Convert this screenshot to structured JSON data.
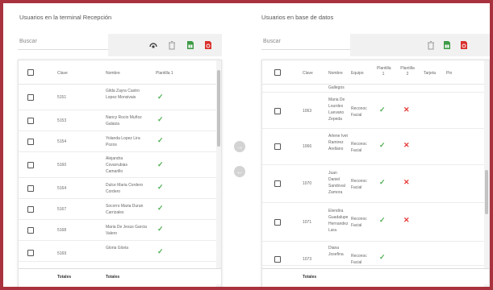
{
  "left_panel": {
    "title": "Usuarios en la terminal Recepción",
    "search_placeholder": "Buscar",
    "columns": [
      "Clave",
      "Nombre",
      "Plantilla 1"
    ],
    "rows": [
      {
        "clave": "5151",
        "nombre": "Gilda Zayra Castro Lopez Monsivais"
      },
      {
        "clave": "5153",
        "nombre": "Nancy Rocio Muñoz Galaiza"
      },
      {
        "clave": "5154",
        "nombre": "Yolanda Lopez Lira Pozos"
      },
      {
        "clave": "5160",
        "nombre": "Alejandra Covarrubias Camarillo"
      },
      {
        "clave": "5164",
        "nombre": "Dulce Maria Cordero Cordero"
      },
      {
        "clave": "5167",
        "nombre": "Socorro Maria Duran Carrizales"
      },
      {
        "clave": "5168",
        "nombre": "Maria De Jesus Garcia Valero"
      },
      {
        "clave": "5169",
        "nombre": "Gloria Gloria"
      }
    ],
    "footer": {
      "col1": "Totales",
      "col2": "Totales"
    }
  },
  "right_panel": {
    "title": "Usuarios en base de datos",
    "search_placeholder": "Buscar",
    "columns": [
      "Clave",
      "Nombre",
      "Equipo",
      "Plantilla 1",
      "Plantilla 2",
      "Tarjeta",
      "Pin"
    ],
    "partial_top_text": "Gallegos",
    "rows": [
      {
        "clave": "1063",
        "nombre": "Maria De Lourdes Luevano Zepeda",
        "equipo": "Reconoc Facial"
      },
      {
        "clave": "1066",
        "nombre": "Arlene Ivet Ramirez Arellano",
        "equipo": "Reconoc Facial"
      },
      {
        "clave": "1070",
        "nombre": "Juan Daniel Sandoval Zamora",
        "equipo": "Reconoc Facial"
      },
      {
        "clave": "1071",
        "nombre": "Elendira Guadalupe Hernandez Lara",
        "equipo": "Reconoc Facial"
      },
      {
        "clave": "1073",
        "nombre": "Diana Josefina",
        "equipo": "Reconoc Facial"
      }
    ],
    "footer": {
      "col1": "Totales"
    }
  },
  "colors": {
    "frame": "#a8323e",
    "check": "#4caf50",
    "cross": "#e53935",
    "excel": "#3d9b45",
    "pdf": "#d9302c"
  }
}
